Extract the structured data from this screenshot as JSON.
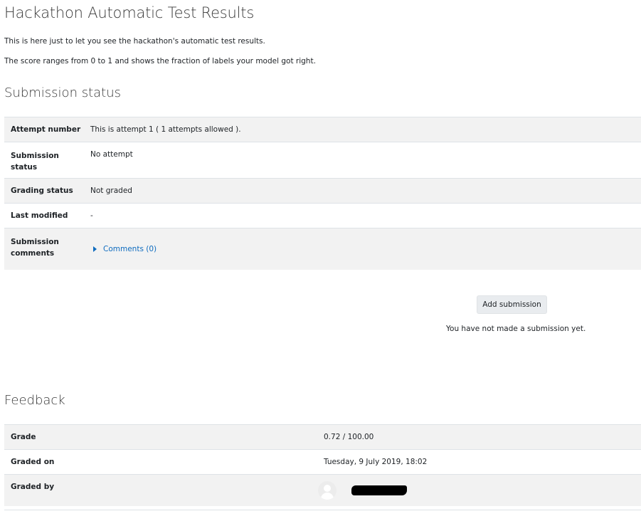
{
  "page": {
    "title": "Hackathon Automatic Test Results",
    "intro_1": "This is here just to let you see the hackathon's automatic test results.",
    "intro_2": "The score ranges from 0 to 1 and shows the fraction of labels your model got right."
  },
  "submission": {
    "heading": "Submission status",
    "rows": [
      {
        "label": "Attempt number",
        "value": "This is attempt 1 ( 1 attempts allowed )."
      },
      {
        "label": "Submission status",
        "value": "No attempt"
      },
      {
        "label": "Grading status",
        "value": "Not graded"
      },
      {
        "label": "Last modified",
        "value": "-"
      },
      {
        "label": "Submission comments",
        "value": "Comments (0)"
      }
    ],
    "add_button": "Add submission",
    "note": "You have not made a submission yet."
  },
  "feedback": {
    "heading": "Feedback",
    "rows": [
      {
        "label": "Grade",
        "value": "0.72 / 100.00"
      },
      {
        "label": "Graded on",
        "value": "Tuesday, 9 July 2019, 18:02"
      },
      {
        "label": "Graded by",
        "value": ""
      }
    ]
  },
  "icons": {
    "comments_toggle": "caret-right-icon",
    "grader_avatar": "user-avatar-icon"
  },
  "colors": {
    "link": "#0f6cbf",
    "row_shade": "#f2f2f2",
    "button_bg": "#e9ecef"
  }
}
